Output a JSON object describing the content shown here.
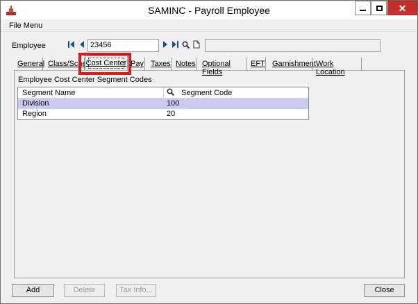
{
  "window": {
    "title": "SAMINC - Payroll Employee"
  },
  "menu": {
    "file": "File Menu"
  },
  "employee": {
    "label": "Employee",
    "id_value": "23456",
    "name_value": ""
  },
  "tabs": [
    {
      "label": "General"
    },
    {
      "label": "Class/Sched"
    },
    {
      "label": "Cost Center"
    },
    {
      "label": "Pay"
    },
    {
      "label": "Taxes"
    },
    {
      "label": "Notes"
    },
    {
      "label": "Optional Fields"
    },
    {
      "label": "EFT"
    },
    {
      "label": "Garnishment"
    },
    {
      "label": "Work Location"
    }
  ],
  "active_tab": "Cost Center",
  "section": {
    "title": "Employee Cost Center Segment Codes"
  },
  "grid": {
    "columns": [
      "Segment Name",
      "Segment Code"
    ],
    "rows": [
      {
        "name": "Division",
        "code": "100"
      },
      {
        "name": "Region",
        "code": "20"
      }
    ],
    "selected_row": 0
  },
  "buttons": {
    "add": "Add",
    "delete": "Delete",
    "tax_info": "Tax Info...",
    "close": "Close"
  },
  "colors": {
    "close_button": "#c7302a",
    "highlight_box": "#d31c1c",
    "selected_row": "#cacaf0",
    "nav_icon": "#1a4fa0"
  },
  "icons": {
    "first": "first-record-icon",
    "prev": "previous-record-icon",
    "next": "next-record-icon",
    "last": "last-record-icon",
    "finder": "finder-icon",
    "new": "new-document-icon"
  }
}
